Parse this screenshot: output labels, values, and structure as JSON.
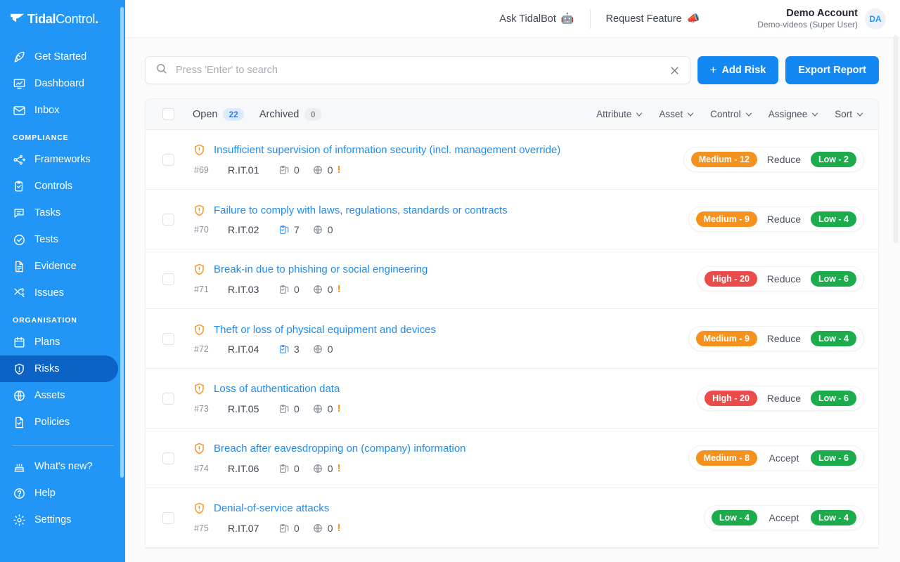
{
  "brand": {
    "name_bold": "Tidal",
    "name_light": "Control",
    "dot": ".",
    "sidebar_color": "#2196F7",
    "accent": "#1388f2"
  },
  "sidebar": {
    "top_items": [
      {
        "label": "Get Started",
        "icon": "rocket-icon"
      },
      {
        "label": "Dashboard",
        "icon": "dashboard-icon"
      },
      {
        "label": "Inbox",
        "icon": "envelope-icon"
      }
    ],
    "sections": [
      {
        "label": "COMPLIANCE",
        "items": [
          {
            "label": "Frameworks",
            "icon": "frameworks-icon"
          },
          {
            "label": "Controls",
            "icon": "clipboard-check-icon"
          },
          {
            "label": "Tasks",
            "icon": "chat-icon"
          },
          {
            "label": "Tests",
            "icon": "check-circle-icon"
          },
          {
            "label": "Evidence",
            "icon": "document-icon"
          },
          {
            "label": "Issues",
            "icon": "tools-icon"
          }
        ]
      },
      {
        "label": "ORGANISATION",
        "items": [
          {
            "label": "Plans",
            "icon": "calendar-icon"
          },
          {
            "label": "Risks",
            "icon": "shield-alert-icon",
            "active": true
          },
          {
            "label": "Assets",
            "icon": "globe-icon"
          },
          {
            "label": "Policies",
            "icon": "policy-icon"
          }
        ]
      }
    ],
    "bottom_items": [
      {
        "label": "What's new?",
        "icon": "cake-icon"
      },
      {
        "label": "Help",
        "icon": "question-circle-icon"
      },
      {
        "label": "Settings",
        "icon": "gear-icon"
      }
    ]
  },
  "topbar": {
    "ask_bot": {
      "label": "Ask TidalBot",
      "emoji": "🤖"
    },
    "request_feature": {
      "label": "Request Feature",
      "emoji": "📣"
    },
    "account": {
      "name": "Demo Account",
      "subtitle": "Demo-videos (Super User)",
      "initials": "DA"
    }
  },
  "toolbar": {
    "search_placeholder": "Press 'Enter' to search",
    "search_value": "",
    "add_risk_label": "Add Risk",
    "add_risk_plus": "+",
    "export_label": "Export Report"
  },
  "list_header": {
    "tabs": [
      {
        "label": "Open",
        "count": "22",
        "style": "blue"
      },
      {
        "label": "Archived",
        "count": "0",
        "style": "grey"
      }
    ],
    "filters": [
      {
        "label": "Attribute"
      },
      {
        "label": "Asset"
      },
      {
        "label": "Control"
      },
      {
        "label": "Assignee"
      },
      {
        "label": "Sort"
      }
    ]
  },
  "rows": [
    {
      "id": "#69",
      "code": "R.IT.01",
      "title": "Insufficient supervision of information security (incl. management override)",
      "controls": "0",
      "assets": "0",
      "warning": "!",
      "controls_active": false,
      "severity": "Medium - 12",
      "severity_class": "medium",
      "treatment": "Reduce",
      "residual": "Low - 2",
      "residual_class": "low"
    },
    {
      "id": "#70",
      "code": "R.IT.02",
      "title": "Failure to comply with laws, regulations, standards or contracts",
      "controls": "7",
      "assets": "0",
      "warning": "",
      "controls_active": true,
      "severity": "Medium - 9",
      "severity_class": "medium",
      "treatment": "Reduce",
      "residual": "Low - 4",
      "residual_class": "low"
    },
    {
      "id": "#71",
      "code": "R.IT.03",
      "title": "Break-in due to phishing or social engineering",
      "controls": "0",
      "assets": "0",
      "warning": "!",
      "controls_active": false,
      "severity": "High - 20",
      "severity_class": "high",
      "treatment": "Reduce",
      "residual": "Low - 6",
      "residual_class": "low"
    },
    {
      "id": "#72",
      "code": "R.IT.04",
      "title": "Theft or loss of physical equipment and devices",
      "controls": "3",
      "assets": "0",
      "warning": "",
      "controls_active": true,
      "severity": "Medium - 9",
      "severity_class": "medium",
      "treatment": "Reduce",
      "residual": "Low - 4",
      "residual_class": "low"
    },
    {
      "id": "#73",
      "code": "R.IT.05",
      "title": "Loss of authentication data",
      "controls": "0",
      "assets": "0",
      "warning": "!",
      "controls_active": false,
      "severity": "High - 20",
      "severity_class": "high",
      "treatment": "Reduce",
      "residual": "Low - 6",
      "residual_class": "low"
    },
    {
      "id": "#74",
      "code": "R.IT.06",
      "title": "Breach after eavesdropping on (company) information",
      "controls": "0",
      "assets": "0",
      "warning": "!",
      "controls_active": false,
      "severity": "Medium - 8",
      "severity_class": "medium",
      "treatment": "Accept",
      "residual": "Low - 6",
      "residual_class": "low"
    },
    {
      "id": "#75",
      "code": "R.IT.07",
      "title": "Denial-of-service attacks",
      "controls": "0",
      "assets": "0",
      "warning": "!",
      "controls_active": false,
      "severity": "Low - 4",
      "severity_class": "low",
      "treatment": "Accept",
      "residual": "Low - 4",
      "residual_class": "low"
    }
  ]
}
